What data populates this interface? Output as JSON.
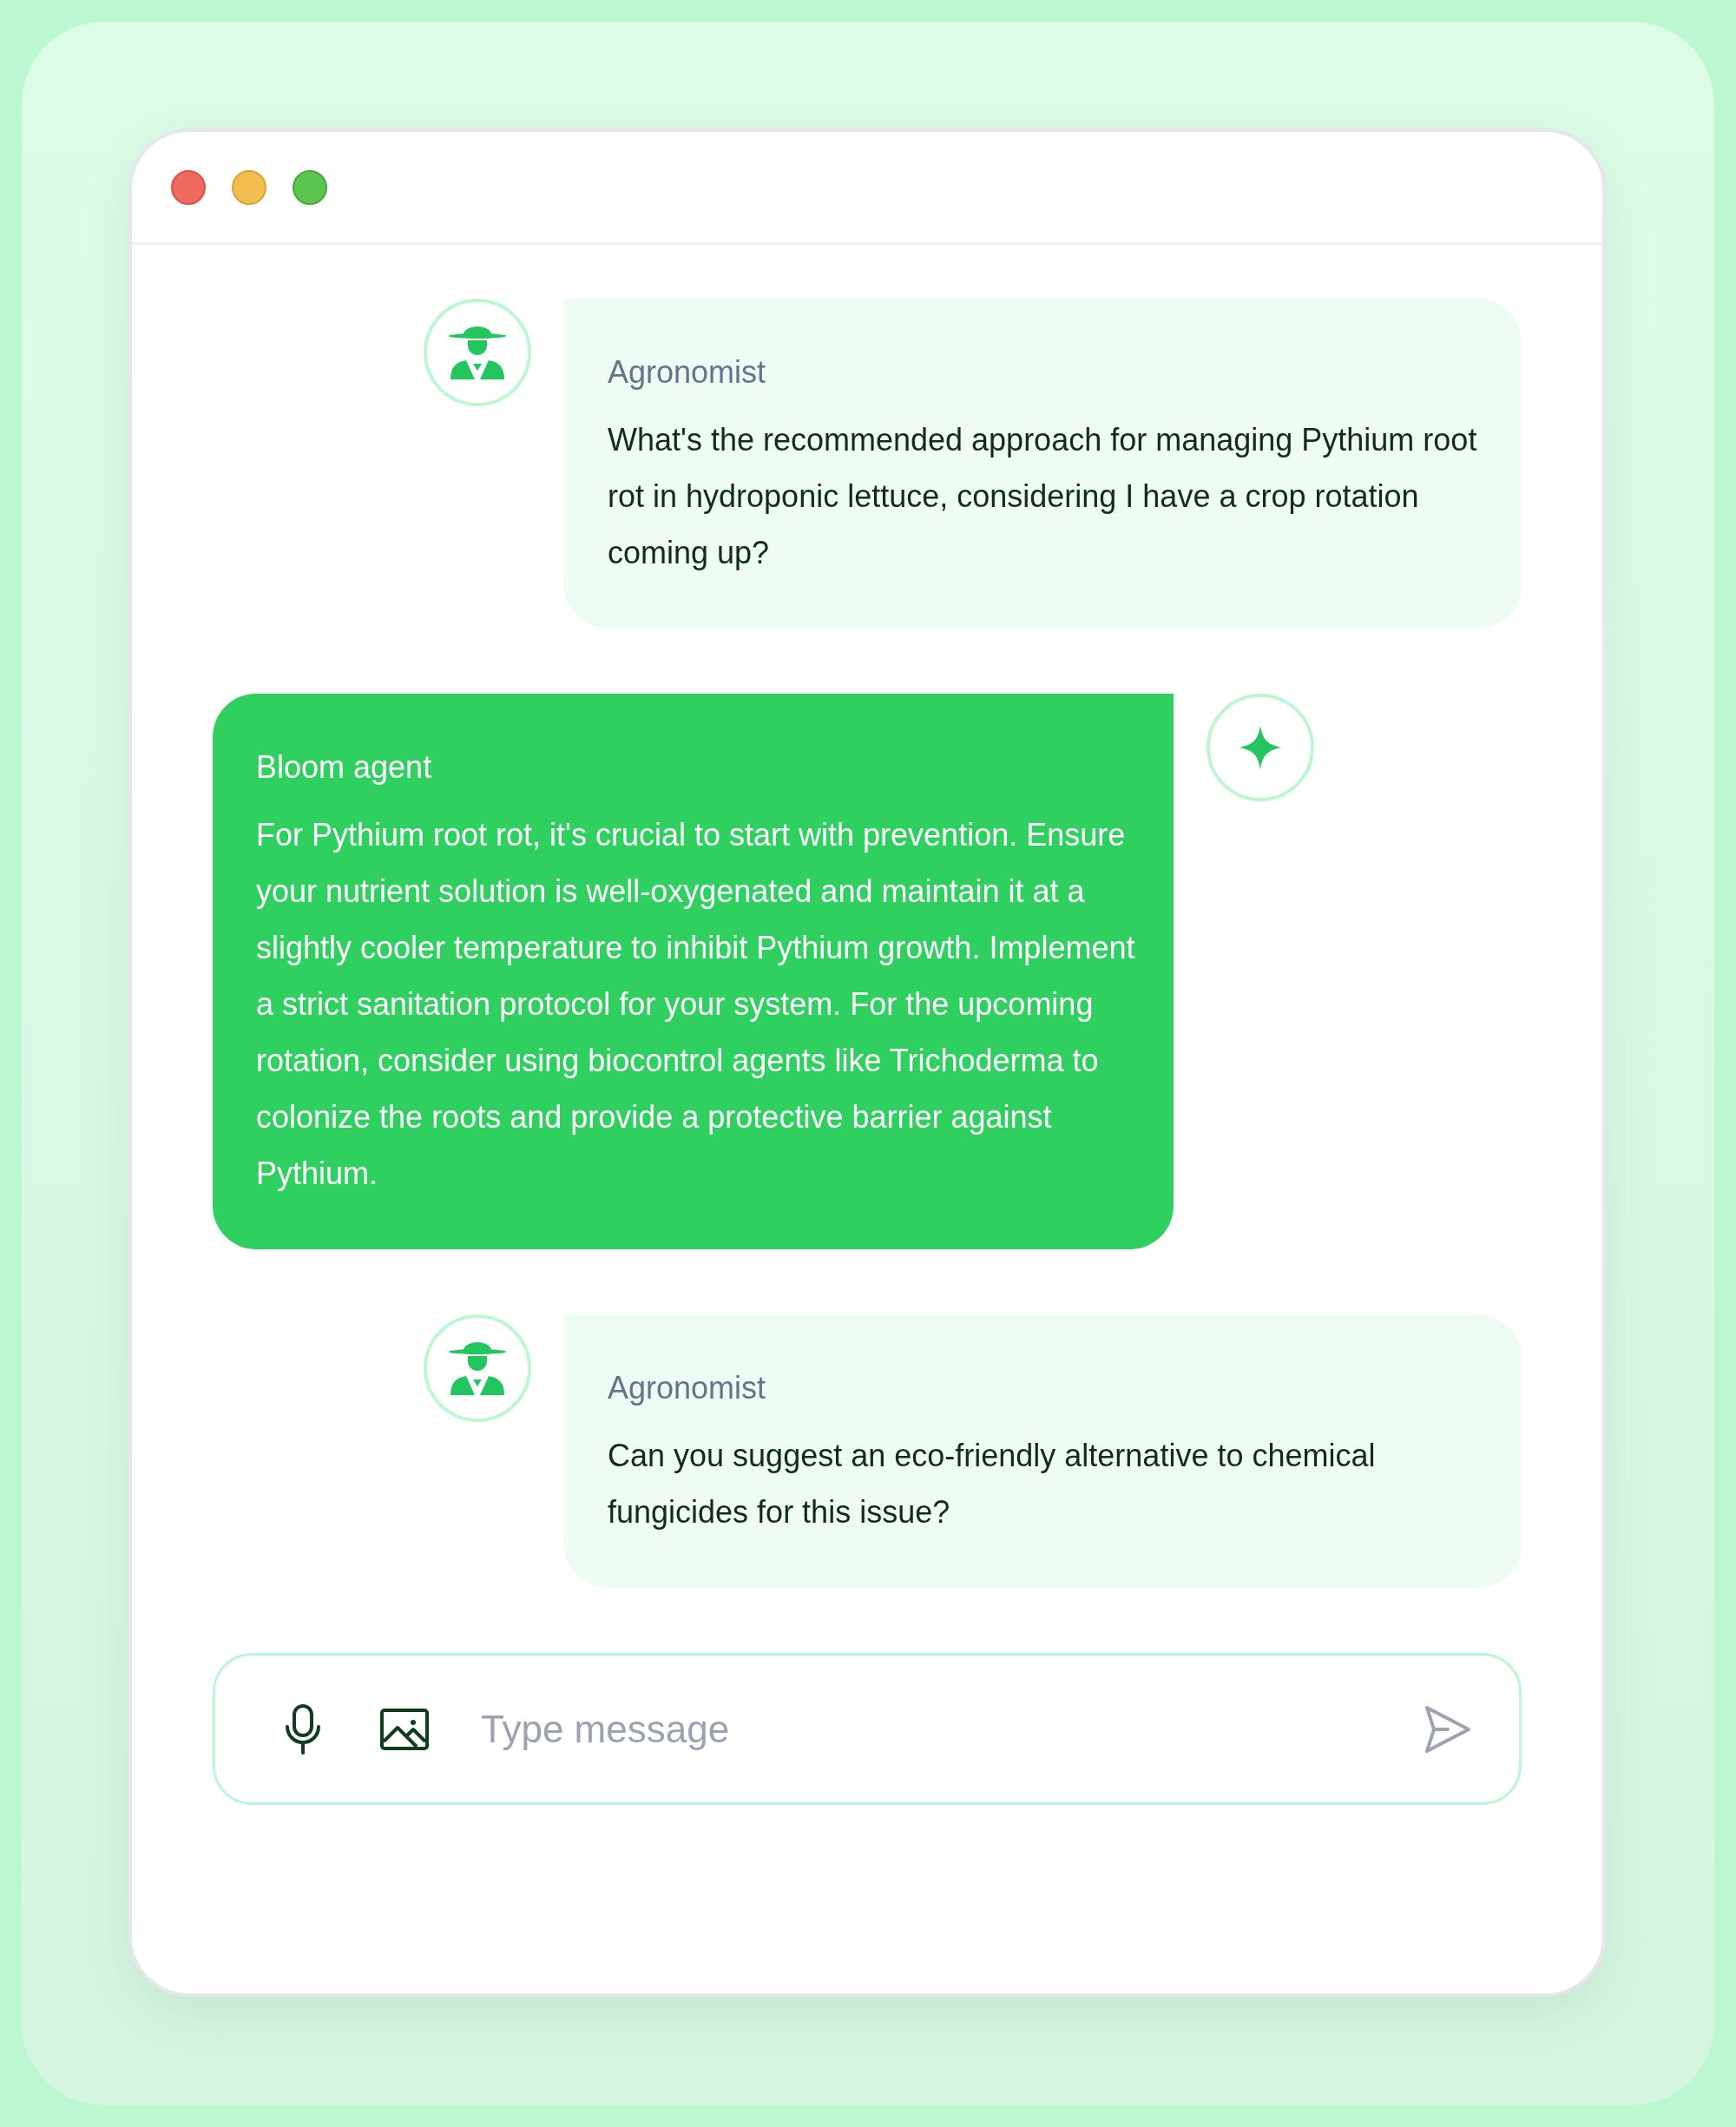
{
  "messages": [
    {
      "kind": "user",
      "sender": "Agronomist",
      "text": "What's the recommended approach for managing Pythium root rot in hydroponic lettuce, considering I have a crop rotation coming up?"
    },
    {
      "kind": "agent",
      "sender": "Bloom agent",
      "text": "For Pythium root rot, it's crucial to start with prevention. Ensure your nutrient solution is well-oxygenated and maintain it at a slightly cooler temperature to inhibit Pythium growth. Implement a strict sanitation protocol for your system. For the upcoming rotation, consider using biocontrol agents like Trichoderma to colonize the roots and provide a protective barrier against Pythium."
    },
    {
      "kind": "user",
      "sender": "Agronomist",
      "text": "Can you suggest an eco-friendly alternative to chemical fungicides for this issue?"
    }
  ],
  "composer": {
    "placeholder": "Type message"
  }
}
